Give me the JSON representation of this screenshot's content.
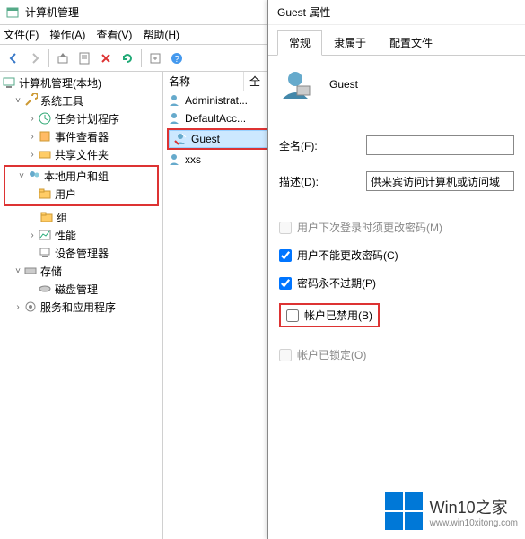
{
  "window": {
    "title": "计算机管理"
  },
  "menubar": {
    "file": "文件(F)",
    "action": "操作(A)",
    "view": "查看(V)",
    "help": "帮助(H)"
  },
  "tree": {
    "root": "计算机管理(本地)",
    "system_tools": "系统工具",
    "task_scheduler": "任务计划程序",
    "event_viewer": "事件查看器",
    "shared_folders": "共享文件夹",
    "local_users_groups": "本地用户和组",
    "users": "用户",
    "groups": "组",
    "performance": "性能",
    "device_manager": "设备管理器",
    "storage": "存储",
    "disk_management": "磁盘管理",
    "services_apps": "服务和应用程序"
  },
  "list": {
    "col_name": "名称",
    "col_full": "全",
    "rows": {
      "admin": "Administrat...",
      "default": "DefaultAcc...",
      "guest": "Guest",
      "xxs": "xxs"
    }
  },
  "dialog": {
    "title": "Guest 属性",
    "tabs": {
      "general": "常规",
      "member_of": "隶属于",
      "profile": "配置文件"
    },
    "user_name": "Guest",
    "fullname_label": "全名(F):",
    "fullname_value": "",
    "description_label": "描述(D):",
    "description_value": "供来宾访问计算机或访问域",
    "checks": {
      "must_change": "用户下次登录时须更改密码(M)",
      "cannot_change": "用户不能更改密码(C)",
      "never_expires": "密码永不过期(P)",
      "disabled": "帐户已禁用(B)",
      "locked": "帐户已锁定(O)"
    }
  },
  "watermark": {
    "brand": "Win10之家",
    "url": "www.win10xitong.com"
  }
}
